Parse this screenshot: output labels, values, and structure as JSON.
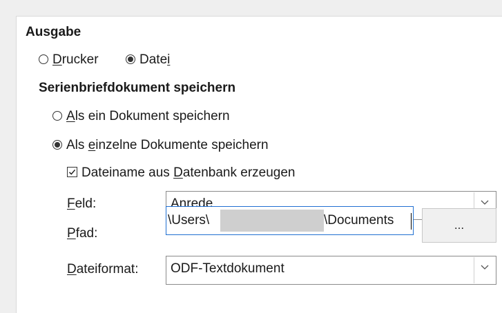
{
  "output": {
    "heading": "Ausgabe",
    "printer_pre": "",
    "printer_u": "D",
    "printer_post": "rucker",
    "file_pre": "Date",
    "file_u": "i",
    "file_post": "",
    "selected": "Datei"
  },
  "save": {
    "heading": "Serienbriefdokument speichern",
    "single_u": "A",
    "single_post": "ls ein Dokument speichern",
    "individual_pre": "Als ",
    "individual_u": "e",
    "individual_post": "inzelne Dokumente speichern",
    "selected": "Als einzelne Dokumente speichern"
  },
  "filename_checkbox": {
    "pre": "Dateiname aus ",
    "u": "D",
    "post": "atenbank erzeugen",
    "checked": true
  },
  "field": {
    "label_u": "F",
    "label_post": "eld:",
    "value": "Anrede"
  },
  "path": {
    "label_u": "P",
    "label_post": "fad:",
    "value_start": "\\Users\\",
    "value_end": "\\Documents",
    "browse_label": "..."
  },
  "format": {
    "label_u": "D",
    "label_post": "ateiformat:",
    "value": "ODF-Textdokument"
  },
  "colors": {
    "focus_border": "#1f6fd1",
    "background": "#efefef"
  }
}
